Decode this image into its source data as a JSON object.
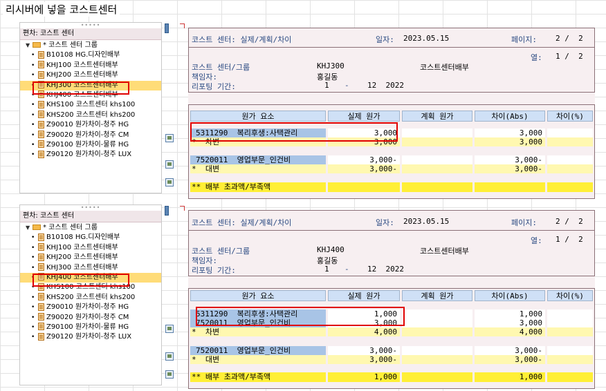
{
  "caption": "리시버에 넣을 코스트센터",
  "colors": {
    "header_blue": "#cfe0f6",
    "row_blue": "#a8c4e6",
    "subtotal_yellow": "#fff8b0",
    "total_yellow": "#ffef36",
    "selection": "#ffdc78",
    "highlight_red": "#e00000"
  },
  "panels": [
    {
      "tree": {
        "header": "편차: 코스트 센터",
        "grip": "•••••",
        "group": "* 코스트 센터 그룹",
        "items": [
          "B10108 HG.디자인배부",
          "KHJ100 코스트센터배부",
          "KHJ200 코스트센터배부",
          "KHJ300 코스트센터배부",
          "KHJ400 코스트센터배부",
          "KHS100 코스트센터 khs100",
          "KHS200 코스트센터 khs200",
          "Z90010 원가차이-청주 HG",
          "Z90020 원가차이-청주 CM",
          "Z90100 원가차이-물류 HG",
          "Z90120 원가차이-청주 LUX"
        ]
      },
      "header": {
        "title": "코스트 센터: 실제/계획/차이",
        "date_label": "일자:",
        "date": "2023.05.15",
        "page_label": "페이지:",
        "page": "2 /  2",
        "col_label": "열:",
        "col": "1 /  2",
        "group_label": "코스트 센터/그룹",
        "group_value": "KHJ300",
        "group_desc": "코스트센터배부",
        "owner_label": "책임자:",
        "owner": "홍길동",
        "period_label": "리포팅 기간:",
        "period_from": "1",
        "period_dash": "-",
        "period_to": "12  2022"
      },
      "columns": [
        "원가 요소",
        "실제 원가",
        "계획 원가",
        "차이(Abs)",
        "차이(%)"
      ],
      "rows": [
        {
          "label": "5311290  복리후생:사택관리",
          "actual": "3,000",
          "plan": "",
          "diff": "3,000",
          "pct": ""
        },
        {
          "label": "*  차변",
          "actual": "3,000",
          "plan": "",
          "diff": "3,000",
          "pct": ""
        },
        {
          "label": "7520011  영업부문_인건비",
          "actual": "3,000-",
          "plan": "",
          "diff": "3,000-",
          "pct": ""
        },
        {
          "label": "*  대변",
          "actual": "3,000-",
          "plan": "",
          "diff": "3,000-",
          "pct": ""
        },
        {
          "label": "** 배부 초과액/부족액",
          "actual": "",
          "plan": "",
          "diff": "",
          "pct": ""
        }
      ]
    },
    {
      "tree": {
        "header": "편차: 코스트 센터",
        "grip": "•••••",
        "group": "* 코스트 센터 그룹",
        "items": [
          "B10108 HG.디자인배부",
          "KHJ100 코스트센터배부",
          "KHJ200 코스트센터배부",
          "KHJ300 코스트센터배부",
          "KHJ400 코스트센터배부",
          "KHS100 코스트센터 khs100",
          "KHS200 코스트센터 khs200",
          "Z90010 원가차이-청주 HG",
          "Z90020 원가차이-청주 CM",
          "Z90100 원가차이-물류 HG",
          "Z90120 원가차이-청주 LUX"
        ]
      },
      "header": {
        "title": "코스트 센터: 실제/계획/차이",
        "date_label": "일자:",
        "date": "2023.05.15",
        "page_label": "페이지:",
        "page": "2 /  2",
        "col_label": "열:",
        "col": "1 /  2",
        "group_label": "코스트 센터/그룹",
        "group_value": "KHJ400",
        "group_desc": "코스트센터배부",
        "owner_label": "책임자:",
        "owner": "홍길동",
        "period_label": "리포팅 기간:",
        "period_from": "1",
        "period_dash": "-",
        "period_to": "12  2022"
      },
      "columns": [
        "원가 요소",
        "실제 원가",
        "계획 원가",
        "차이(Abs)",
        "차이(%)"
      ],
      "rows": [
        {
          "label": "5311290  복리후생:사택관리",
          "actual": "1,000",
          "plan": "",
          "diff": "1,000",
          "pct": ""
        },
        {
          "label": "7520011  영업부문_인건비",
          "actual": "3,000",
          "plan": "",
          "diff": "3,000",
          "pct": ""
        },
        {
          "label": "*  차변",
          "actual": "4,000",
          "plan": "",
          "diff": "4,000",
          "pct": ""
        },
        {
          "label": "7520011  영업부문_인건비",
          "actual": "3,000-",
          "plan": "",
          "diff": "3,000-",
          "pct": ""
        },
        {
          "label": "*  대변",
          "actual": "3,000-",
          "plan": "",
          "diff": "3,000-",
          "pct": ""
        },
        {
          "label": "** 배부 초과액/부족액",
          "actual": "1,000",
          "plan": "",
          "diff": "1,000",
          "pct": ""
        }
      ]
    }
  ]
}
